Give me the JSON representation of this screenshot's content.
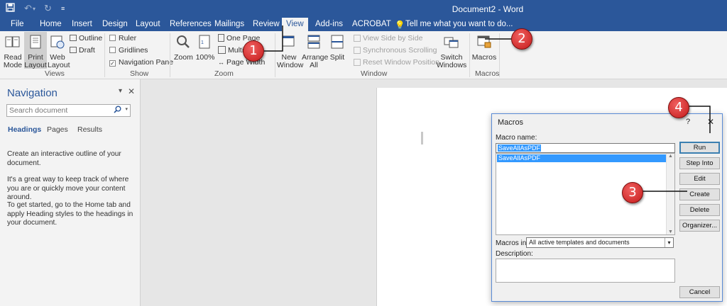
{
  "titlebar": {
    "title": "Document2 - Word",
    "save_icon": "save-icon",
    "undo_icon": "undo-icon",
    "redo_icon": "redo-icon"
  },
  "tabs": [
    "File",
    "Home",
    "Insert",
    "Design",
    "Layout",
    "References",
    "Mailings",
    "Review",
    "View",
    "Add-ins",
    "ACROBAT"
  ],
  "tell_me": "Tell me what you want to do...",
  "ribbon": {
    "views": {
      "label": "Views",
      "read_mode": "Read Mode",
      "print_layout": "Print Layout",
      "web_layout": "Web Layout",
      "outline": "Outline",
      "draft": "Draft"
    },
    "show": {
      "label": "Show",
      "ruler": "Ruler",
      "gridlines": "Gridlines",
      "navigation_pane": "Navigation Pane"
    },
    "zoom": {
      "label": "Zoom",
      "zoom": "Zoom",
      "hundred": "100%",
      "one_page": "One Page",
      "multiple": "Multi",
      "page_width": "Page Width"
    },
    "window": {
      "label": "Window",
      "new_window": "New Window",
      "arrange_all": "Arrange All",
      "split": "Split",
      "side_by_side": "View Side by Side",
      "sync_scroll": "Synchronous Scrolling",
      "reset_pos": "Reset Window Position",
      "switch_windows": "Switch Windows"
    },
    "macros": {
      "label": "Macros",
      "button": "Macros"
    }
  },
  "nav": {
    "title": "Navigation",
    "search_placeholder": "Search document",
    "tabs": [
      "Headings",
      "Pages",
      "Results"
    ],
    "para1": "Create an interactive outline of your document.",
    "para2": "It's a great way to keep track of where you are or quickly move your content around.",
    "para3": "To get started, go to the Home tab and apply Heading styles to the headings in your document."
  },
  "dialog": {
    "title": "Macros",
    "help": "?",
    "close": "✕",
    "macro_name_label": "Macro name:",
    "macro_name_value": "SaveAllAsPDF",
    "macros": [
      "SaveAllAsPDF"
    ],
    "macros_in_label": "Macros in:",
    "macros_in_value": "All active templates and documents",
    "description_label": "Description:",
    "buttons": {
      "run": "Run",
      "step_into": "Step Into",
      "edit": "Edit",
      "create": "Create",
      "delete": "Delete",
      "organizer": "Organizer...",
      "cancel": "Cancel"
    }
  },
  "callouts": [
    "1",
    "2",
    "3",
    "4"
  ],
  "colors": {
    "word_blue": "#2b579a",
    "callout_red": "#d42a2a",
    "selection": "#3399ff"
  }
}
